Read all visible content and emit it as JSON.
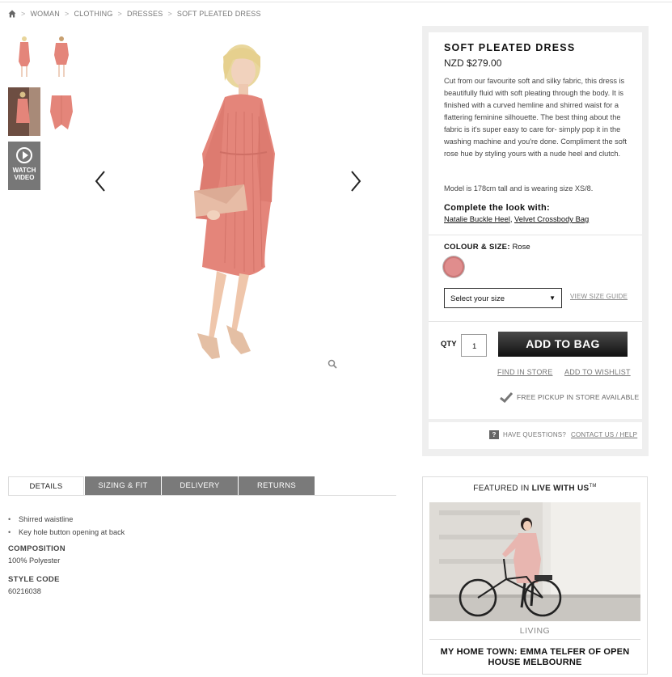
{
  "breadcrumb": {
    "home_icon": "home-icon",
    "items": [
      "WOMAN",
      "CLOTHING",
      "DRESSES",
      "SOFT PLEATED DRESS"
    ],
    "separator": ">"
  },
  "gallery": {
    "video_label_1": "WATCH",
    "video_label_2": "VIDEO",
    "prev_arrow": "‹",
    "next_arrow": "›"
  },
  "product": {
    "title": "SOFT PLEATED DRESS",
    "price": "NZD $279.00",
    "description": "Cut from our favourite soft and silky fabric, this dress is beautifully fluid with soft pleating through the body. It is finished with a curved hemline and shirred waist for a flattering feminine silhouette. The best thing about the fabric is it's super easy to care for- simply pop it in the washing machine and you're done. Compliment the soft rose hue by styling yours with a nude heel and clutch.",
    "model_info": "Model is 178cm tall and is wearing size XS/8.",
    "complete_look_heading": "Complete the look with:",
    "complete_look_links": [
      "Natalie Buckle Heel",
      "Velvet Crossbody Bag"
    ],
    "complete_look_sep": ", ",
    "colour_size_label": "COLOUR & SIZE:",
    "colour_value": "Rose",
    "swatch_color": "#e08d8d",
    "size_select_value": "Select your size",
    "size_guide": "VIEW SIZE GUIDE",
    "qty_label": "QTY",
    "qty_value": "1",
    "add_to_bag": "ADD TO BAG",
    "find_in_store": "FIND IN STORE",
    "add_to_wishlist": "ADD TO WISHLIST",
    "pickup_text": "FREE PICKUP IN STORE AVAILABLE",
    "questions_icon": "?",
    "questions_text": "HAVE QUESTIONS?",
    "contact_link": "CONTACT US / HELP"
  },
  "details": {
    "tabs": [
      "DETAILS",
      "SIZING & FIT",
      "DELIVERY",
      "RETURNS"
    ],
    "active_tab": "DETAILS",
    "bullets": [
      "Shirred waistline",
      "Key hole button opening at back"
    ],
    "composition_label": "COMPOSITION",
    "composition_value": "100% Polyester",
    "style_code_label": "STYLE CODE",
    "style_code_value": "60216038"
  },
  "featured": {
    "prefix": "FEATURED IN",
    "name": "LIVE WITH US",
    "trademark": "TM",
    "category": "LIVING",
    "title": "MY HOME TOWN: EMMA TELFER OF OPEN HOUSE MELBOURNE"
  },
  "colors": {
    "dress": "#e4857a",
    "button_dark": "#111111",
    "tab_inactive": "#7a7a7a",
    "panel_bg": "#efefef"
  }
}
